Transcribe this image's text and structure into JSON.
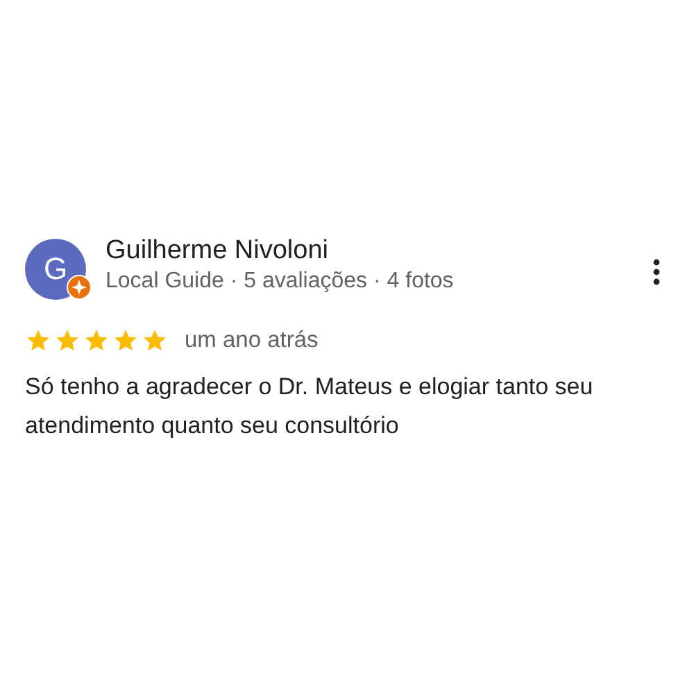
{
  "review": {
    "avatar_letter": "G",
    "author": "Guilherme Nivoloni",
    "meta": "Local Guide · 5 avaliações · 4 fotos",
    "stars": 5,
    "time": "um ano atrás",
    "text": "Só tenho a agradecer o Dr. Mateus e elogiar tanto seu atendimento quanto seu consultório"
  }
}
